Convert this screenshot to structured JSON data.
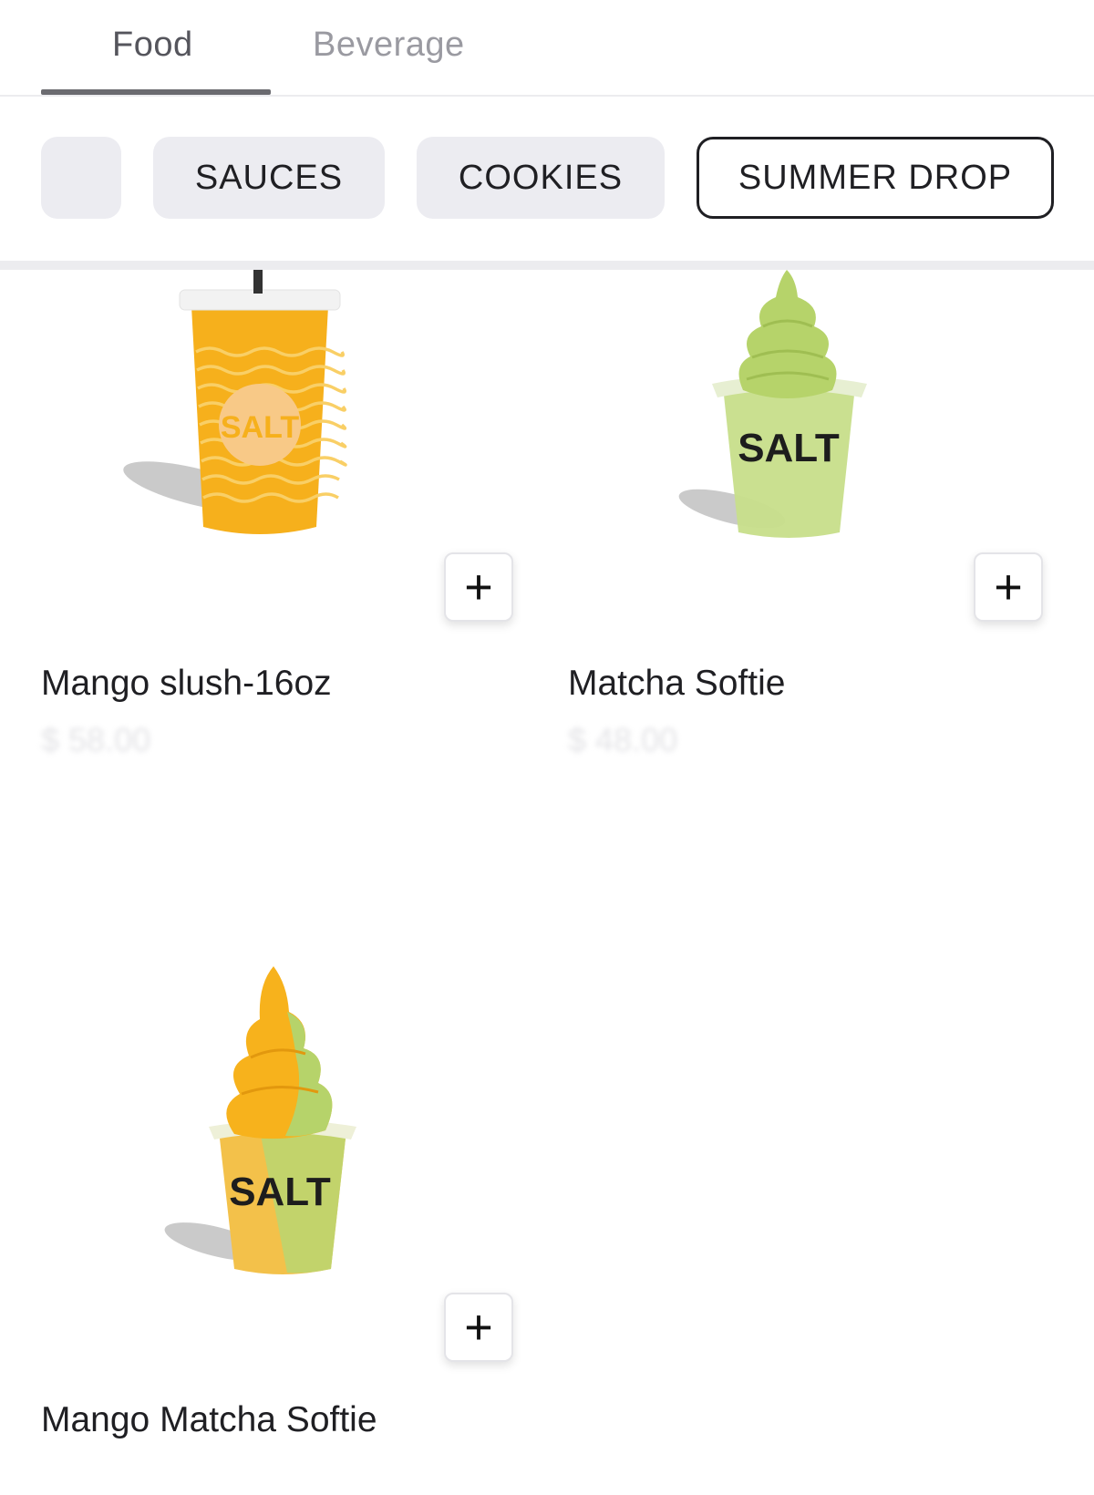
{
  "tabs": [
    {
      "label": "Food",
      "active": true
    },
    {
      "label": "Beverage",
      "active": false
    }
  ],
  "categories": {
    "partial_label": "",
    "items": [
      {
        "label": "SAUCES",
        "selected": false
      },
      {
        "label": "COOKIES",
        "selected": false
      },
      {
        "label": "SUMMER DROP",
        "selected": true
      }
    ]
  },
  "products": [
    {
      "name": "Mango slush-16oz",
      "price": "$ 58.00",
      "image": "mango-slush-cup-image",
      "brand_mark": "SALT",
      "add_label": "+"
    },
    {
      "name": "Matcha Softie",
      "price": "$ 48.00",
      "image": "matcha-softie-image",
      "brand_mark": "SALT",
      "add_label": "+"
    },
    {
      "name": "Mango Matcha Softie",
      "price": "",
      "image": "mango-matcha-softie-image",
      "brand_mark": "SALT",
      "add_label": "+"
    }
  ],
  "colors": {
    "accent_border": "#1f1f23",
    "chip_bg": "#ececf1",
    "mango": "#f7b21c",
    "matcha": "#b6d36a"
  }
}
